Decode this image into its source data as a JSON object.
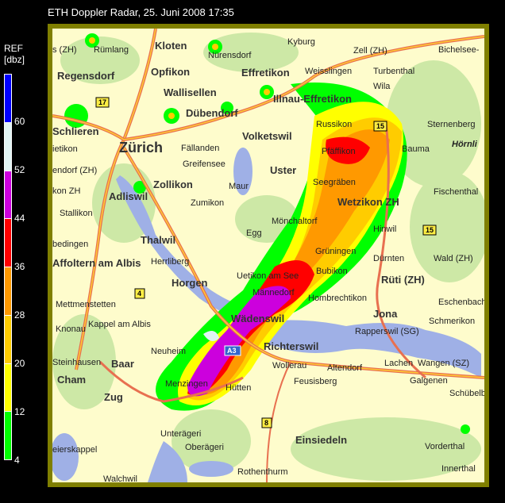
{
  "title": "ETH Doppler Radar, 25. Juni 2008 17:35",
  "legend": {
    "label": "REF",
    "unit": "[dbz]",
    "colors": [
      "#0000ff",
      "#e0f4f4",
      "#cc00dd",
      "#ff0000",
      "#ff9900",
      "#ffcc00",
      "#ffff00",
      "#00ff00"
    ],
    "ticks": [
      "60",
      "52",
      "44",
      "36",
      "28",
      "20",
      "12",
      "4"
    ]
  },
  "places": {
    "kloten": "Kloten",
    "ruemlang": "Rümlang",
    "sZH": "s (ZH)",
    "nuerensdorf": "Nürensdorf",
    "kyburg": "Kyburg",
    "zell": "Zell (ZH)",
    "bichelsee": "Bichelsee-",
    "regensdorf": "Regensdorf",
    "opfikon": "Opfikon",
    "effretikon": "Effretikon",
    "weisslingen": "Weisslingen",
    "turbenthal": "Turbenthal",
    "wila": "Wila",
    "wallisellen": "Wallisellen",
    "illnau": "Illnau-Effretikon",
    "duebendorf": "Dübendorf",
    "volketswil": "Volketswil",
    "russikon": "Russikon",
    "sternenberg": "Sternenberg",
    "schlieren": "Schlieren",
    "zuerich": "Zürich",
    "faellanden": "Fällanden",
    "pfaeffikon": "Pfäffikon",
    "bauma": "Bauma",
    "hoernli": "Hörnli",
    "ietikon": "ietikon",
    "greifensee": "Greifensee",
    "uster": "Uster",
    "endorf": "endorf (ZH)",
    "zollikon": "Zollikon",
    "maur": "Maur",
    "seegraeben": "Seegräben",
    "wetzikon": "Wetzikon ZH",
    "fischenthal": "Fischenthal",
    "konZH": "kon ZH",
    "zumikon": "Zumikon",
    "adliswil": "Adliswil",
    "stallikon": "Stallikon",
    "moenchaltorf": "Mönchaltorf",
    "hinwil": "Hinwil",
    "egg": "Egg",
    "thalwil": "Thalwil",
    "bedingen": "bedingen",
    "grueningen": "Grüningen",
    "duernten": "Dürnten",
    "wald": "Wald (ZH)",
    "affoltern": "Affoltern am Albis",
    "herrliberg": "Herrliberg",
    "horgen": "Horgen",
    "uetikon": "Uetikon am See",
    "bubikon": "Bubikon",
    "rueti": "Rüti (ZH)",
    "maennedorf": "Männedorf",
    "hombrechtikon": "Hombrechtikon",
    "mettmenstetten": "Mettmenstetten",
    "eschenbach": "Eschenbach",
    "jona": "Jona",
    "waedenswil": "Wädenswil",
    "kappel": "Kappel am Albis",
    "schmerikon": "Schmerikon",
    "knonau": "Knonau",
    "rapperswil": "Rapperswil (SG)",
    "neuheim": "Neuheim",
    "richterswil": "Richterswil",
    "baar": "Baar",
    "steinhausen": "Steinhausen",
    "wollerau": "Wollerau",
    "altendorf": "Altendorf",
    "lachen": "Lachen",
    "wangen": "Wangen (SZ)",
    "cham": "Cham",
    "galgenen": "Galgenen",
    "feusisberg": "Feusisberg",
    "menzingen": "Menzingen",
    "huetten": "Hütten",
    "schuebelbach": "Schübelb",
    "zug": "Zug",
    "unteraegeri": "Unterägeri",
    "einsiedeln": "Einsiedeln",
    "vorderthal": "Vorderthal",
    "oberaegeri": "Oberägeri",
    "eierskappel": "eierskappel",
    "innerthal": "Innerthal",
    "rothenthurm": "Rothenthurm",
    "walchwil": "Walchwil"
  },
  "shields": {
    "r17": "17",
    "r15a": "15",
    "r15b": "15",
    "r4": "4",
    "a3": "A3",
    "r8": "8"
  }
}
